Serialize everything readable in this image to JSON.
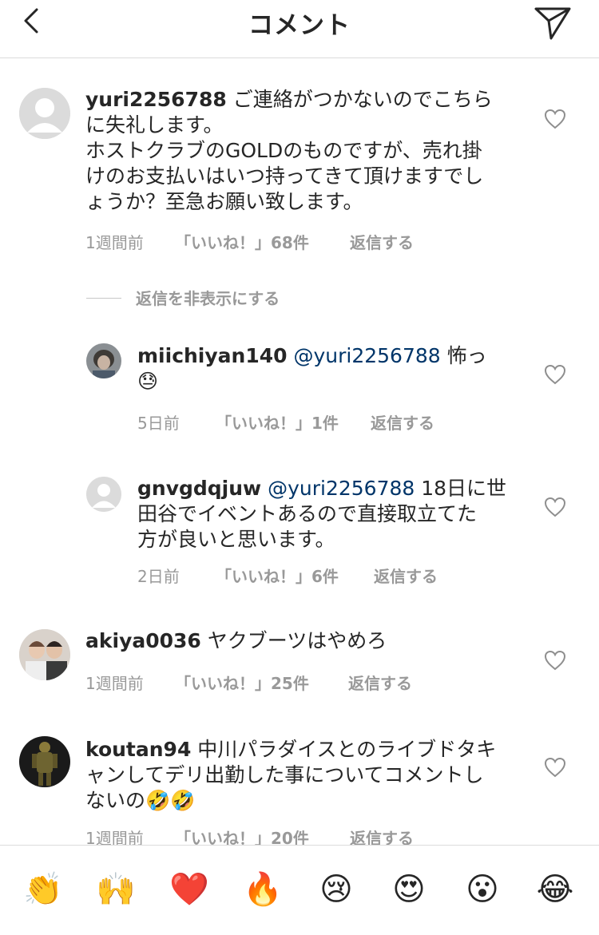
{
  "header": {
    "title": "コメント"
  },
  "comments": [
    {
      "username": "yuri2256788",
      "text1": " ご連絡がつかないのでこちら",
      "text2": "に失礼します。",
      "text3": "ホストクラブのGOLDのものですが、売れ掛",
      "text4": "けのお支払いはいつ持ってきて頂けますでし",
      "text5": "ょうか？至急お願い致します。",
      "time": "1週間前",
      "likes": "「いいね！」68件",
      "reply": "返信する"
    },
    {
      "username": "akiya0036",
      "text1": " ヤクブーツはやめろ",
      "time": "1週間前",
      "likes": "「いいね！」25件",
      "reply": "返信する"
    },
    {
      "username": "koutan94",
      "text1": " 中川パラダイスとのライブドタキ",
      "text2": "ャンしてデリ出勤した事についてコメントし",
      "text3": "ないの🤣🤣",
      "time": "1週間前",
      "likes": "「いいね！」20件",
      "reply": "返信する"
    }
  ],
  "hide_replies": "返信を非表示にする",
  "replies": [
    {
      "username": "miichiyan140",
      "mention": " @yuri2256788",
      "text1": " 怖っ",
      "text2": "😓",
      "time": "5日前",
      "likes": "「いいね！」1件",
      "reply": "返信する"
    },
    {
      "username": "gnvgdqjuw",
      "mention": " @yuri2256788",
      "text1": " 18日に世",
      "text2": "田谷でイベントあるので直接取立てた",
      "text3": "方が良いと思います。",
      "time": "2日前",
      "likes": "「いいね！」6件",
      "reply": "返信する"
    }
  ],
  "emoji_bar": [
    "👏",
    "🙌",
    "❤️",
    "🔥",
    "😢",
    "😍",
    "😮",
    "😂"
  ],
  "colors": {
    "mention": "#003569",
    "meta": "#999999",
    "border": "#dbdbdb"
  }
}
